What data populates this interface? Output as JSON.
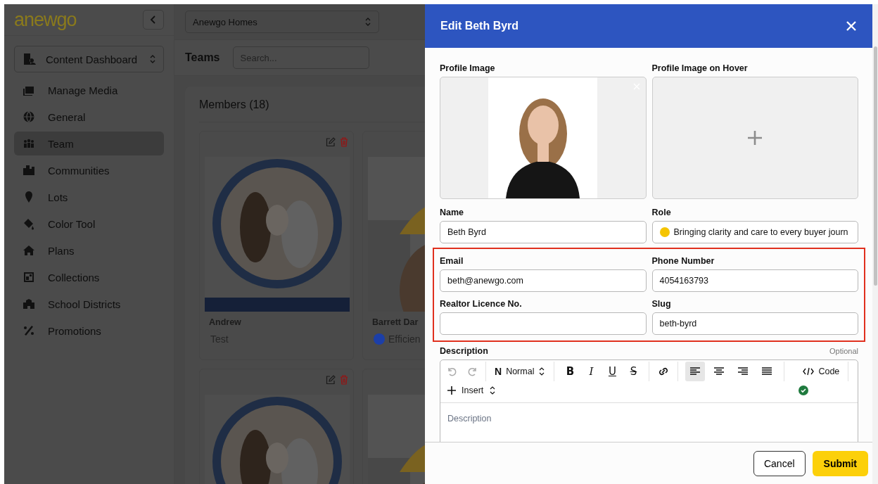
{
  "sidebar": {
    "logo": "anewgo",
    "workspace": "Content Dashboard",
    "items": [
      {
        "label": "Manage Media",
        "selected": false
      },
      {
        "label": "General",
        "selected": false
      },
      {
        "label": "Team",
        "selected": true
      },
      {
        "label": "Communities",
        "selected": false
      },
      {
        "label": "Lots",
        "selected": false
      },
      {
        "label": "Color Tool",
        "selected": false
      },
      {
        "label": "Plans",
        "selected": false
      },
      {
        "label": "Collections",
        "selected": false
      },
      {
        "label": "School Districts",
        "selected": false
      },
      {
        "label": "Promotions",
        "selected": false
      }
    ]
  },
  "topbar": {
    "company": "Anewgo Homes"
  },
  "teams": {
    "title": "Teams",
    "search": {
      "placeholder": "Search..."
    },
    "members_title": "Members (18)",
    "cards": [
      {
        "kind": "picture",
        "actions": true,
        "name": "Andrew",
        "role": "Test"
      },
      {
        "kind": "picture",
        "name": "Barrett Dar",
        "role": "Efficien",
        "color": "#1c3fa8"
      },
      {
        "kind": "picture",
        "actions": true
      },
      {
        "kind": "picture"
      }
    ]
  },
  "drawer": {
    "title": "Edit Beth Byrd",
    "images": [
      {
        "label": "Profile Image",
        "has_image": true
      },
      {
        "label": "Profile Image on Hover",
        "has_image": false
      }
    ],
    "rows": [
      {
        "highlighted": false,
        "fields": [
          {
            "label": "Name",
            "value": "Beth Byrd"
          },
          {
            "label": "Role",
            "value": "Bringing clarity and care to every buyer journ",
            "color": "#f5c400"
          }
        ]
      },
      {
        "highlighted": true,
        "fields": [
          {
            "label": "Email",
            "value": "beth@anewgo.com"
          },
          {
            "label": "Phone Number",
            "value": "4054163793"
          }
        ]
      },
      {
        "highlighted": true,
        "fields": [
          {
            "label": "Realtor Licence No."
          },
          {
            "label": "Slug",
            "value": "beth-byrd"
          }
        ]
      }
    ],
    "description": {
      "label": "Description",
      "hint": "Optional",
      "placeholder": "Description",
      "toolbar": {
        "undo_disabled": true,
        "redo_disabled": true,
        "format_glyph": "N",
        "format": "Normal",
        "marks": [
          "B",
          "I",
          "U",
          "S"
        ],
        "alignments": [
          {
            "selected": true
          },
          {
            "selected": false
          },
          {
            "selected": false
          },
          {
            "selected": false
          }
        ],
        "code": "Code",
        "insert": "Insert",
        "valid": true
      }
    },
    "buttons": {
      "cancel": "Cancel",
      "submit": "Submit"
    }
  }
}
